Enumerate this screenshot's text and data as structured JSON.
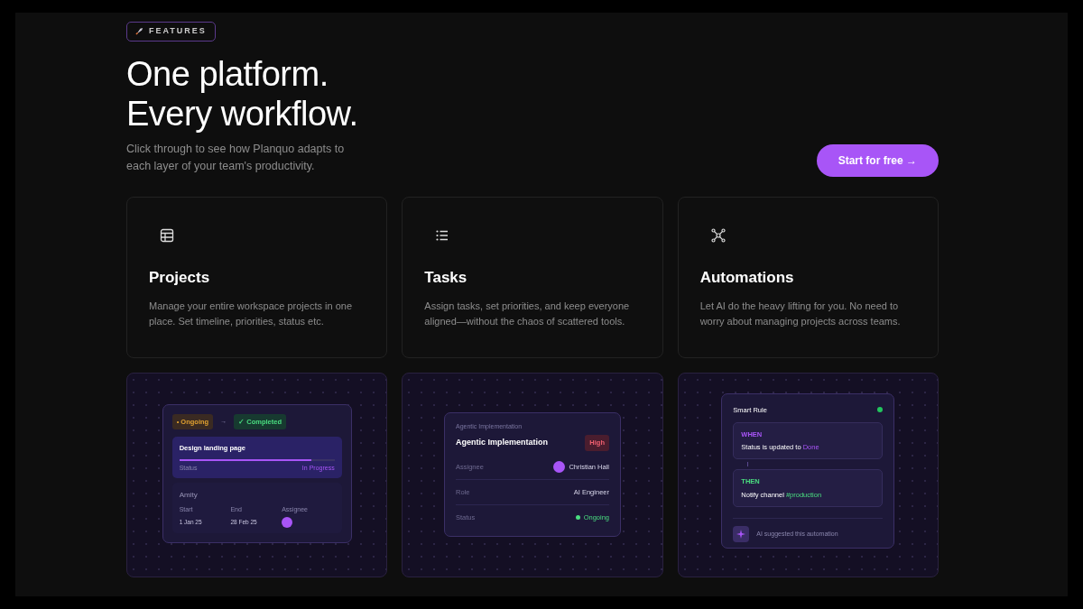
{
  "badge": "FEATURES",
  "heading": [
    "One platform.",
    "Every workflow."
  ],
  "subtitle": "Click through to see how Planquo adapts to each layer of your team's productivity.",
  "cta": "Start for free →",
  "features": [
    {
      "kind": "table",
      "title": "Projects",
      "description": "Manage your entire workspace projects in one place. Set timeline, priorities, status etc."
    },
    {
      "kind": "list",
      "title": "Tasks",
      "description": "Assign tasks, set priorities, and keep everyone aligned—without the chaos of scattered tools."
    },
    {
      "kind": "nodes",
      "title": "Automations",
      "description": "Let AI do the heavy lifting for you. No need to worry about managing projects across teams."
    }
  ],
  "project_preview": {
    "from_status": "• Ongoing",
    "arrow": "→",
    "to_status": "✓ Completed",
    "task": "Design landing page",
    "level": 0.85,
    "status_label": "Status",
    "status_value": "In Progress",
    "project": "Amity",
    "fields": [
      {
        "label": "Start",
        "value": "1 Jan 25"
      },
      {
        "label": "End",
        "value": "28 Feb 25"
      },
      {
        "label": "Assignee",
        "kind": "avatar"
      }
    ]
  },
  "task_preview": {
    "overline": "Agentic Implementation",
    "title": "Agentic Implementation",
    "priority": "High",
    "rows": [
      {
        "label": "Assignee",
        "value": "Christian Hall",
        "kind": "person"
      },
      {
        "label": "Role",
        "value": "AI Engineer",
        "kind": "text"
      },
      {
        "label": "Status",
        "value": "Ongoing",
        "kind": "status"
      }
    ]
  },
  "rule_preview": {
    "title": "Smart Rule",
    "active": true,
    "steps": [
      {
        "label": "WHEN",
        "kind": "when",
        "text": "Status is updated to **Done**"
      },
      {
        "label": "THEN",
        "kind": "then",
        "text": "Notify channel **#production**"
      }
    ],
    "footer": "AI suggested this automation"
  }
}
